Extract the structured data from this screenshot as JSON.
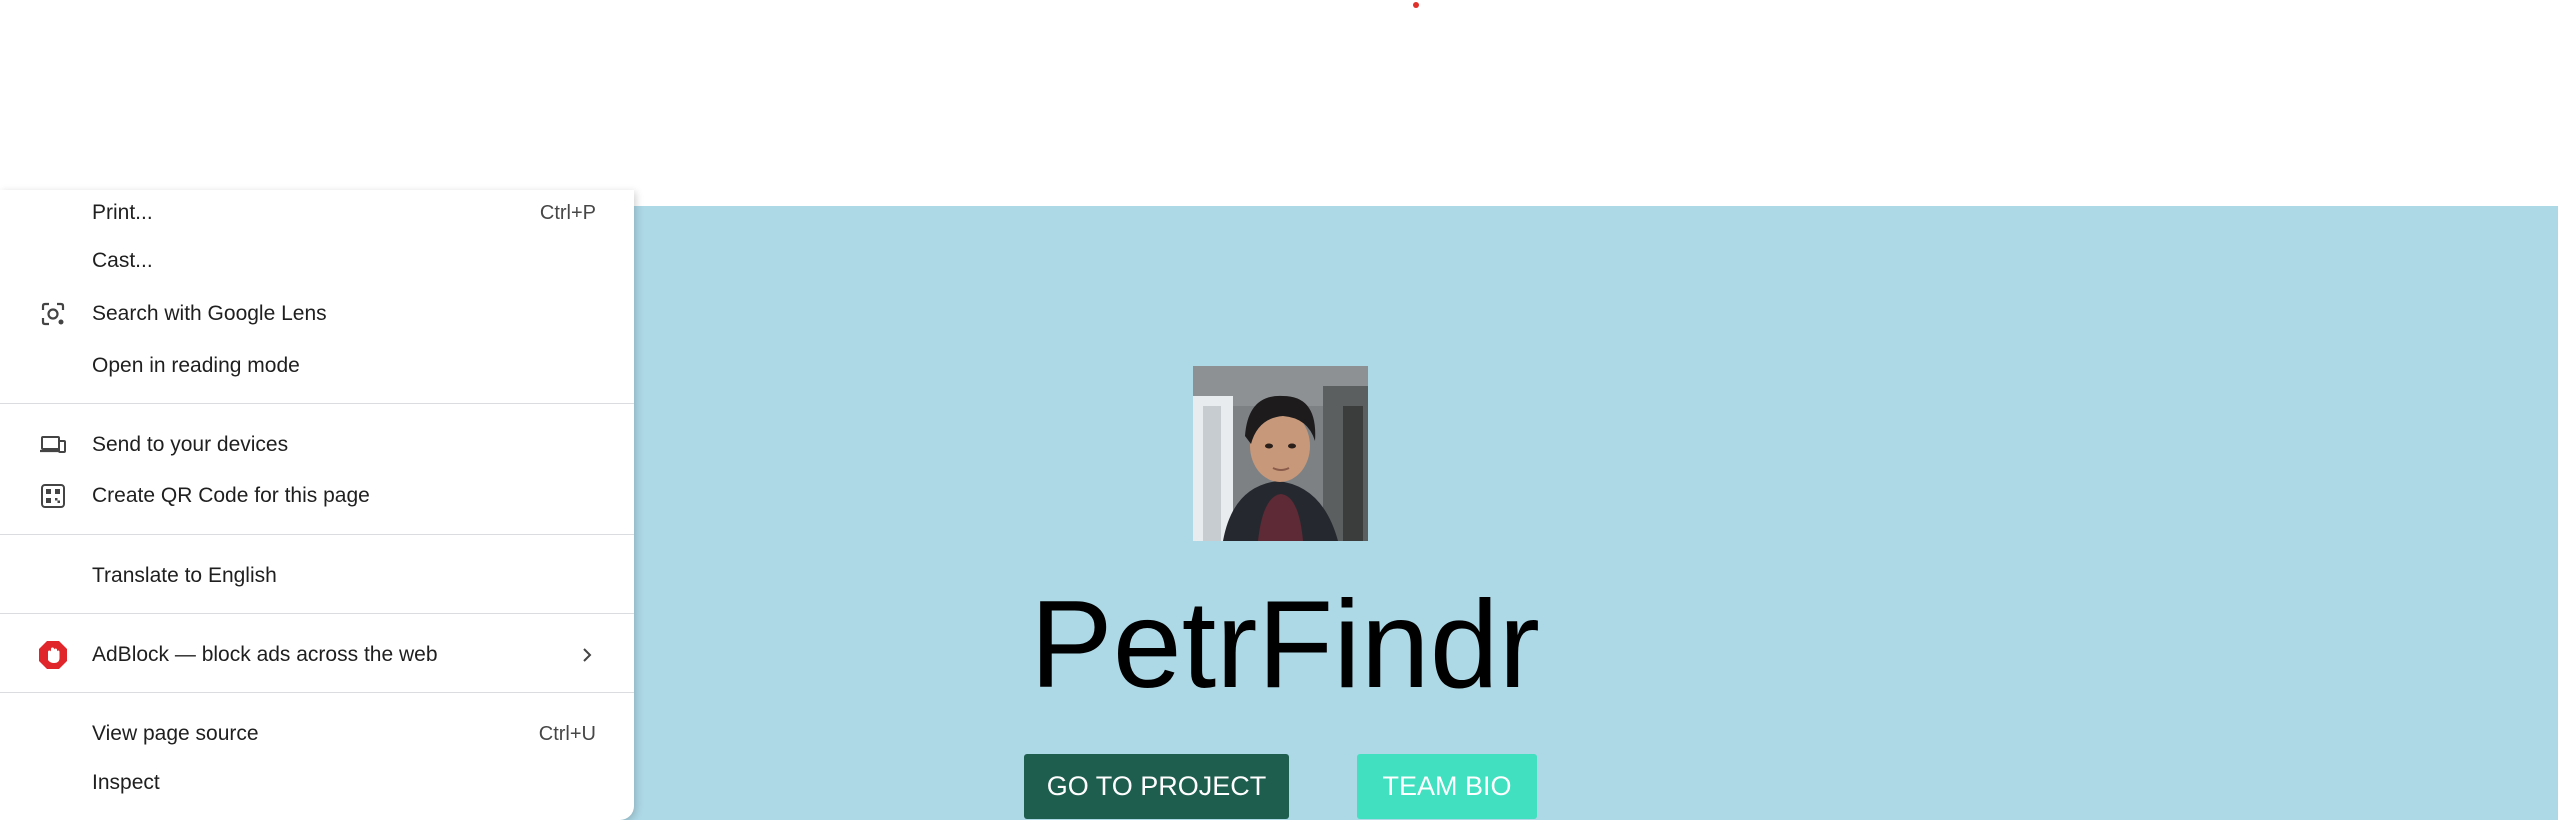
{
  "page": {
    "site_title": "PetrFindr",
    "buttons": {
      "project_label": "GO TO PROJECT",
      "bio_label": "TEAM BIO"
    },
    "colors": {
      "hero_background": "#add8e6",
      "project_button": "#1e5e4e",
      "bio_button": "#40e0c0"
    }
  },
  "context_menu": {
    "items": [
      {
        "label": "Print...",
        "shortcut": "Ctrl+P",
        "icon": ""
      },
      {
        "label": "Cast...",
        "shortcut": "",
        "icon": ""
      },
      {
        "label": "Search with Google Lens",
        "shortcut": "",
        "icon": "google-lens-icon"
      },
      {
        "label": "Open in reading mode",
        "shortcut": "",
        "icon": ""
      },
      {
        "label": "Send to your devices",
        "shortcut": "",
        "icon": "devices-icon"
      },
      {
        "label": "Create QR Code for this page",
        "shortcut": "",
        "icon": "qr-code-icon"
      },
      {
        "label": "Translate to English",
        "shortcut": "",
        "icon": ""
      },
      {
        "label": "AdBlock — block ads across the web",
        "shortcut": "",
        "icon": "adblock-icon"
      },
      {
        "label": "View page source",
        "shortcut": "Ctrl+U",
        "icon": ""
      },
      {
        "label": "Inspect",
        "shortcut": "",
        "icon": ""
      }
    ]
  }
}
